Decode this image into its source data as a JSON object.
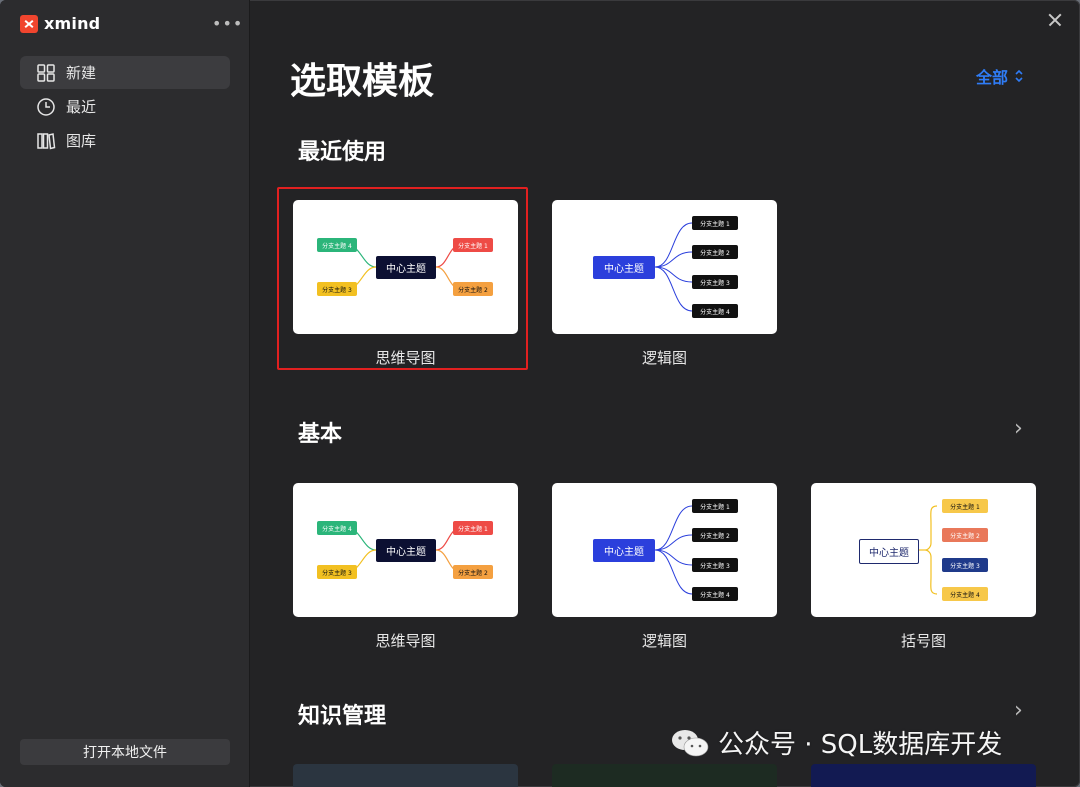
{
  "app": {
    "name": "xmind"
  },
  "sidebar": {
    "items": [
      {
        "label": "新建",
        "icon": "grid-icon"
      },
      {
        "label": "最近",
        "icon": "clock-icon"
      },
      {
        "label": "图库",
        "icon": "library-icon"
      }
    ],
    "open_file_label": "打开本地文件"
  },
  "main": {
    "title": "选取模板",
    "filter_label": "全部",
    "sections": [
      {
        "title": "最近使用",
        "cards": [
          {
            "label": "思维导图"
          },
          {
            "label": "逻辑图"
          }
        ]
      },
      {
        "title": "基本",
        "cards": [
          {
            "label": "思维导图"
          },
          {
            "label": "逻辑图"
          },
          {
            "label": "括号图"
          }
        ]
      },
      {
        "title": "知识管理"
      }
    ]
  },
  "thumbnails": {
    "center": "中心主题",
    "branches": [
      "分支主题 1",
      "分支主题 2",
      "分支主题 3",
      "分支主题 4"
    ]
  },
  "colors": {
    "accent": "#2f7cf6",
    "highlight": "#e12020"
  },
  "watermark": "公众号 · SQL数据库开发"
}
